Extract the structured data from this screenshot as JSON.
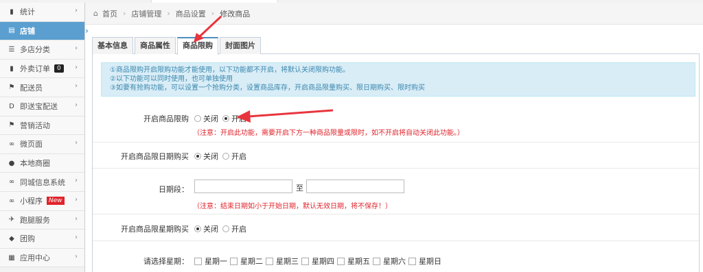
{
  "sidebar": {
    "items": [
      {
        "label": "统计",
        "icon": "bar-chart-icon",
        "glyph": "▮",
        "chevron": "›"
      },
      {
        "label": "店铺",
        "icon": "store-icon",
        "glyph": "▤",
        "chevron": "›",
        "active": true
      },
      {
        "label": "多店分类",
        "icon": "list-icon",
        "glyph": "☰",
        "chevron": "›"
      },
      {
        "label": "外卖订单",
        "icon": "document-icon",
        "glyph": "▮",
        "chevron": "›",
        "badge": "0"
      },
      {
        "label": "配送员",
        "icon": "courier-icon",
        "glyph": "⚑",
        "chevron": "›"
      },
      {
        "label": "即送宝配送",
        "icon": "delivery-d-icon",
        "glyph": "D",
        "chevron": "›"
      },
      {
        "label": "营销活动",
        "icon": "flag-icon",
        "glyph": "⚑",
        "chevron": ""
      },
      {
        "label": "微页面",
        "icon": "link-icon",
        "glyph": "∞",
        "chevron": "›"
      },
      {
        "label": "本地商圈",
        "icon": "globe-icon",
        "glyph": "●",
        "chevron": ""
      },
      {
        "label": "同城信息系统",
        "icon": "link-icon",
        "glyph": "∞",
        "chevron": "›"
      },
      {
        "label": "小程序",
        "icon": "link-icon",
        "glyph": "∞",
        "chevron": "›",
        "new_badge": "New"
      },
      {
        "label": "跑腿服务",
        "icon": "runner-icon",
        "glyph": "✈",
        "chevron": "›"
      },
      {
        "label": "团购",
        "icon": "tag-icon",
        "glyph": "◆",
        "chevron": "›"
      },
      {
        "label": "应用中心",
        "icon": "grid-icon",
        "glyph": "▦",
        "chevron": "›"
      }
    ]
  },
  "breadcrumb": {
    "home_glyph": "⌂",
    "home": "首页",
    "sep": "›",
    "level1": "店铺管理",
    "level2": "商品设置",
    "current": "修改商品"
  },
  "tabs": [
    {
      "label": "基本信息"
    },
    {
      "label": "商品属性"
    },
    {
      "label": "商品限购",
      "active": true
    },
    {
      "label": "封面图片"
    }
  ],
  "notice": {
    "line1": "①商品限购开启限购功能才能使用，以下功能都不开启，将默认关闭限购功能。",
    "line2": "②以下功能可以同时使用，也可单独使用",
    "line3": "③如要有抢购功能，可以设置一个抢购分类，设置商品库存，开启商品限量购买、限日期购买、限时购买"
  },
  "form": {
    "limit": {
      "label": "开启商品限购",
      "off": "关闭",
      "on": "开启",
      "selected": "on",
      "hint": "（注意：开启此功能，需要开启下方一种商品限量或限时，如不开启将自动关闭此功能。）"
    },
    "date_limit": {
      "label": "开启商品限日期购买",
      "off": "关闭",
      "on": "开启",
      "selected": "off"
    },
    "date_range": {
      "label": "日期段：",
      "to": "至",
      "start": "",
      "end": "",
      "hint": "（注意：结束日期如小于开始日期，默认无效日期，将不保存！）"
    },
    "week_limit": {
      "label": "开启商品限星期购买",
      "off": "关闭",
      "on": "开启",
      "selected": "off"
    },
    "weekdays": {
      "label": "请选择星期：",
      "days": [
        "星期一",
        "星期二",
        "星期三",
        "星期四",
        "星期五",
        "星期六",
        "星期日"
      ]
    }
  },
  "colors": {
    "accent": "#5a9fd0",
    "arrow": "#e8353d",
    "hint": "#e0232b",
    "notice_bg": "#d9edf7"
  }
}
